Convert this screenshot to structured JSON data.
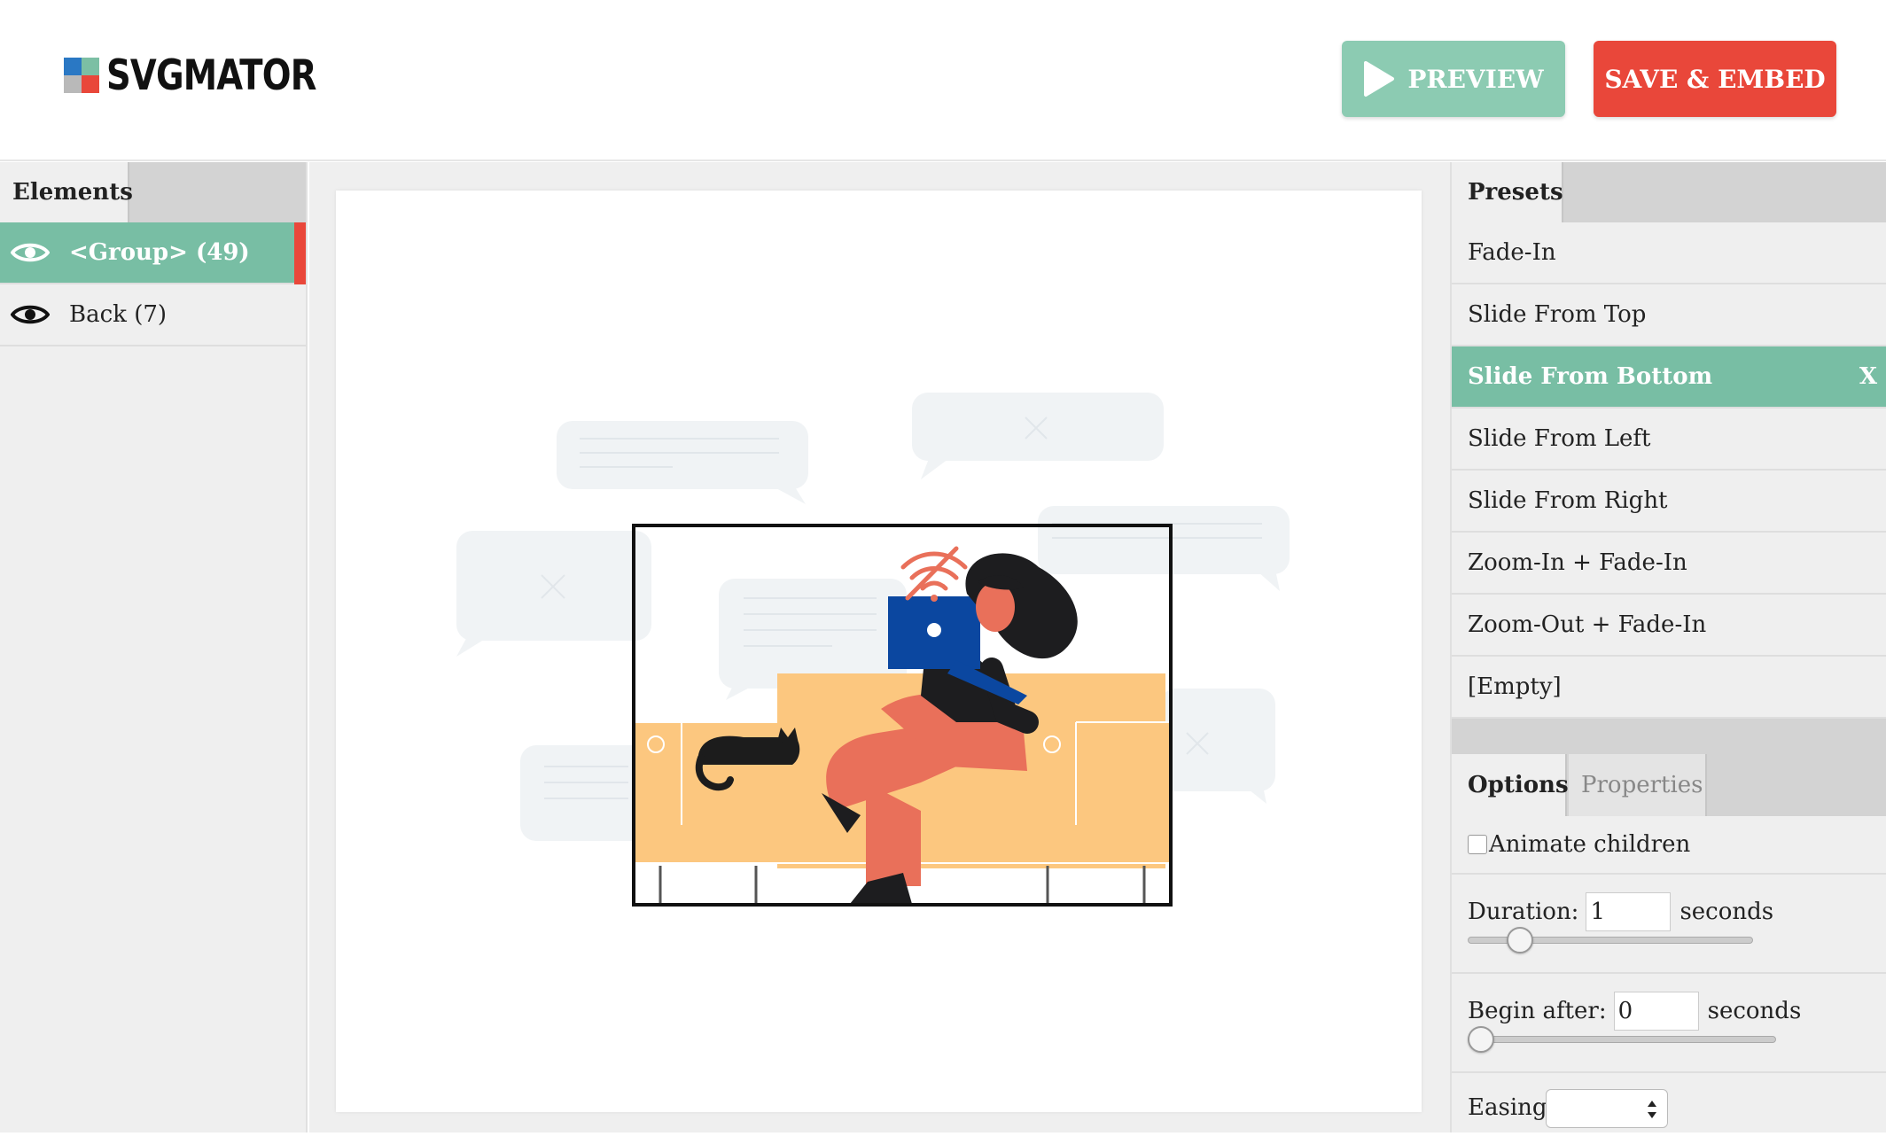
{
  "header": {
    "logo_text": "SVGMATOR",
    "logo_colors": [
      "#2a78c4",
      "#7cbfa4",
      "#b9b9b9",
      "#e9473a"
    ],
    "preview_label": "PREVIEW",
    "save_label": "SAVE & EMBED"
  },
  "elements_panel": {
    "tab_label": "Elements",
    "items": [
      {
        "label": "<Group> (49)",
        "selected": true
      },
      {
        "label": "Back (7)",
        "selected": false
      }
    ]
  },
  "presets_panel": {
    "tab_label": "Presets",
    "items": [
      {
        "label": "Fade-In",
        "selected": false
      },
      {
        "label": "Slide From Top",
        "selected": false
      },
      {
        "label": "Slide From Bottom",
        "selected": true,
        "remove": "X"
      },
      {
        "label": "Slide From Left",
        "selected": false
      },
      {
        "label": "Slide From Right",
        "selected": false
      },
      {
        "label": "Zoom-In + Fade-In",
        "selected": false
      },
      {
        "label": "Zoom-Out + Fade-In",
        "selected": false
      },
      {
        "label": "[Empty]",
        "selected": false
      }
    ]
  },
  "options_panel": {
    "tabs": [
      "Options",
      "Properties"
    ],
    "animate_children_label": "Animate children",
    "animate_children_checked": false,
    "duration_label": "Duration:",
    "duration_value": "1",
    "duration_unit": "seconds",
    "duration_slider_fraction": 0.15,
    "begin_after_label": "Begin after:",
    "begin_after_value": "0",
    "begin_after_unit": "seconds",
    "begin_after_slider_fraction": 0.0,
    "easing_label": "Easing:",
    "easing_value": ""
  },
  "colors": {
    "accent_green": "#78bea4",
    "accent_red": "#e9473a",
    "panel_bg": "#efefef"
  }
}
